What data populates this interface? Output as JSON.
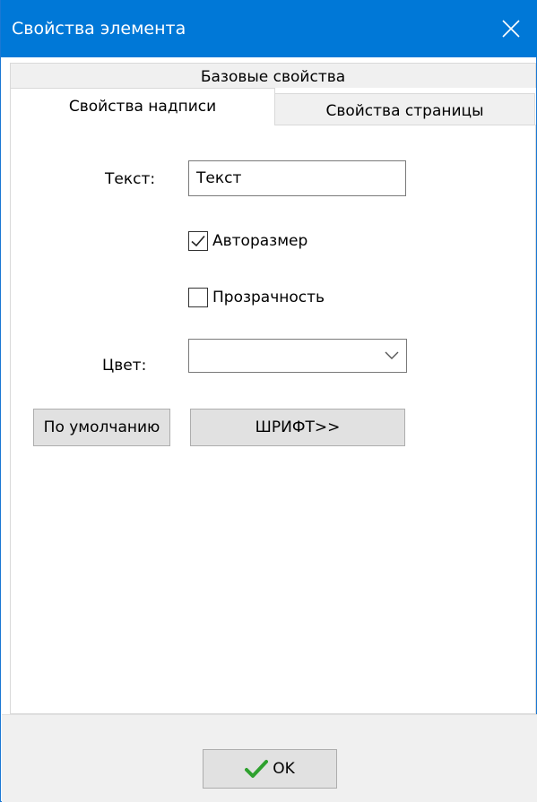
{
  "window": {
    "title": "Свойства элемента"
  },
  "tabs": {
    "base": "Базовые свойства",
    "label_props": "Свойства надписи",
    "page_props": "Свойства страницы"
  },
  "form": {
    "text_label": "Текст:",
    "text_value": "Текст",
    "autosize_label": "Авторазмер",
    "autosize_checked": true,
    "transparency_label": "Прозрачность",
    "transparency_checked": false,
    "color_label": "Цвет:",
    "color_value": ""
  },
  "buttons": {
    "default_label": "По умолчанию",
    "font_label": "ШРИФТ>>",
    "ok_label": "OK"
  },
  "colors": {
    "titlebar": "#0078d7",
    "ok_check": "#2fa12f"
  },
  "icons": {
    "close": "close-icon",
    "dropdown": "chevron-down-icon",
    "check": "checkmark-icon",
    "ok": "ok-check-icon"
  }
}
